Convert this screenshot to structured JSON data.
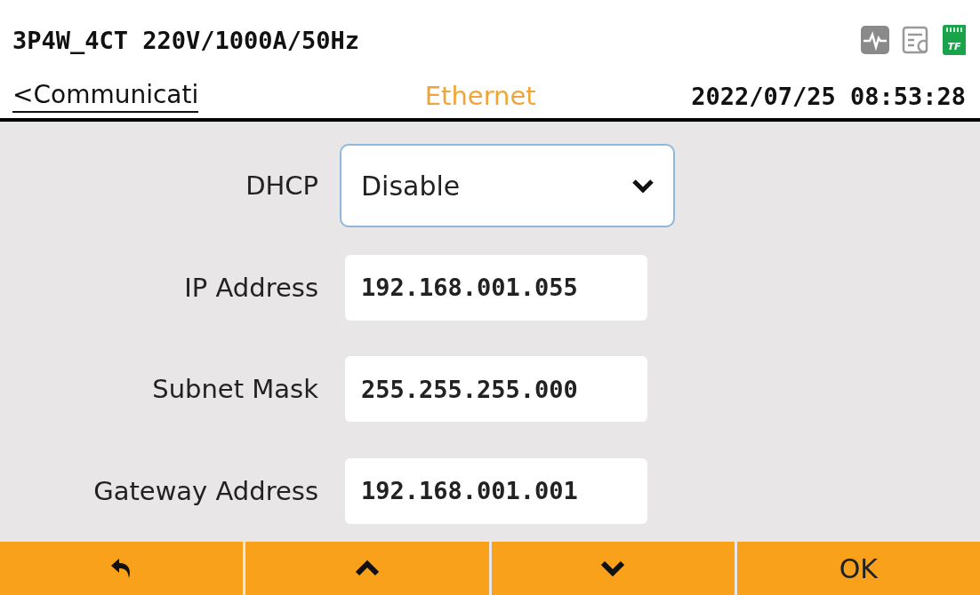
{
  "header": {
    "wiring": "3P4W_4CT 220V/1000A/50Hz",
    "back_link": "<Communicati",
    "title": "Ethernet",
    "datetime": "2022/07/25 08:53:28",
    "card_label": "TF"
  },
  "fields": [
    {
      "label": "DHCP",
      "kind": "dropdown",
      "value": "Disable",
      "focused": true
    },
    {
      "label": "IP Address",
      "kind": "text",
      "value": "192.168.001.055",
      "focused": false
    },
    {
      "label": "Subnet Mask",
      "kind": "text",
      "value": "255.255.255.000",
      "focused": false
    },
    {
      "label": "Gateway Address",
      "kind": "text",
      "value": "192.168.001.001",
      "focused": false
    }
  ],
  "footer": [
    {
      "kind": "back"
    },
    {
      "kind": "up"
    },
    {
      "kind": "down"
    },
    {
      "kind": "text",
      "label": "OK"
    }
  ]
}
